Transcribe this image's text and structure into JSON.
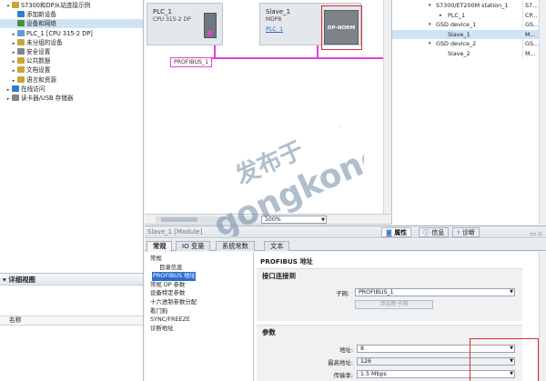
{
  "project_tree": {
    "items": [
      {
        "label": "S7300和DP从站连接示例",
        "indent": 1,
        "icon_color": "#c9a23a",
        "expand": "▾",
        "selected": false
      },
      {
        "label": "添加新设备",
        "indent": 2,
        "icon_color": "#2f7fd0",
        "expand": "",
        "selected": false
      },
      {
        "label": "设备和网络",
        "indent": 2,
        "icon_color": "#4a8f3a",
        "expand": "",
        "selected": true
      },
      {
        "label": "PLC_1 [CPU 315-2 DP]",
        "indent": 2,
        "icon_color": "#5aa0d8",
        "expand": "▸",
        "selected": false
      },
      {
        "label": "未分组的设备",
        "indent": 2,
        "icon_color": "#c9a23a",
        "expand": "▸",
        "selected": false
      },
      {
        "label": "安全设置",
        "indent": 2,
        "icon_color": "#7d8790",
        "expand": "▸",
        "selected": false
      },
      {
        "label": "公共数据",
        "indent": 2,
        "icon_color": "#c9a23a",
        "expand": "▸",
        "selected": false
      },
      {
        "label": "文档设置",
        "indent": 2,
        "icon_color": "#c9a23a",
        "expand": "▸",
        "selected": false
      },
      {
        "label": "语言和资源",
        "indent": 2,
        "icon_color": "#c9a23a",
        "expand": "▸",
        "selected": false
      },
      {
        "label": "在线访问",
        "indent": 1,
        "icon_color": "#2f7fd0",
        "expand": "▸",
        "selected": false
      },
      {
        "label": "读卡器/USB 存储器",
        "indent": 1,
        "icon_color": "#7d8790",
        "expand": "▸",
        "selected": false
      }
    ]
  },
  "detail_view": {
    "title": "详细视图",
    "column_name": "名称"
  },
  "network_view": {
    "plc": {
      "name": "PLC_1",
      "type": "CPU 315-2 DP"
    },
    "slave": {
      "name": "Slave_1",
      "type": "MDP8",
      "link": "PLC_1"
    },
    "dp_norm_label": "DP-NORM",
    "bus_label": "PROFIBUS_1",
    "zoom": "100%"
  },
  "device_overview": {
    "rows": [
      {
        "name": "S7300/ET200M station_1",
        "col2": "S7...",
        "indent": 1,
        "expand": "▾",
        "selected": false
      },
      {
        "name": "PLC_1",
        "col2": "CP...",
        "indent": 2,
        "expand": "▸",
        "selected": false
      },
      {
        "name": "GSD device_1",
        "col2": "GS...",
        "indent": 1,
        "expand": "▾",
        "selected": false
      },
      {
        "name": "Slave_1",
        "col2": "M...",
        "indent": 2,
        "expand": "",
        "selected": true
      },
      {
        "name": "GSD device_2",
        "col2": "GS...",
        "indent": 1,
        "expand": "▾",
        "selected": false
      },
      {
        "name": "Slave_2",
        "col2": "M...",
        "indent": 2,
        "expand": "",
        "selected": false
      }
    ]
  },
  "inspector": {
    "title": "Slave_1 [Module]",
    "top_tabs": {
      "properties": "属性",
      "info": "信息",
      "diagnostics": "诊断"
    },
    "tabs": [
      "常规",
      "IO 变量",
      "系统常数",
      "文本"
    ],
    "nav": [
      {
        "label": "常规",
        "indent": 0,
        "selected": false
      },
      {
        "label": "目录信息",
        "indent": 1,
        "selected": false
      },
      {
        "label": "PROFIBUS 地址",
        "indent": 1,
        "selected": true
      },
      {
        "label": "常规 DP 参数",
        "indent": 0,
        "selected": false
      },
      {
        "label": "设备特定参数",
        "indent": 0,
        "selected": false
      },
      {
        "label": "十六进制参数分配",
        "indent": 0,
        "selected": false
      },
      {
        "label": "看门狗",
        "indent": 0,
        "selected": false
      },
      {
        "label": "SYNC/FREEZE",
        "indent": 0,
        "selected": false
      },
      {
        "label": "诊断地址",
        "indent": 0,
        "selected": false
      }
    ],
    "content_title": "PROFIBUS 地址",
    "interface_section": {
      "title": "接口连接到",
      "subnet_label": "子网:",
      "subnet_value": "PROFIBUS_1",
      "add_subnet_button": "添加新子网"
    },
    "params_section": {
      "title": "参数",
      "address_label": "地址:",
      "address_value": "8",
      "highest_label": "最高地址:",
      "highest_value": "126",
      "baud_label": "传输率:",
      "baud_value": "1.5 Mbps"
    }
  },
  "watermark": {
    "line1": "发布于",
    "line2": "gongkong",
    "mark": "®"
  },
  "colors": {
    "bus": "#e242d6",
    "highlight": "#d9302c",
    "selection": "#2c6fd1"
  }
}
